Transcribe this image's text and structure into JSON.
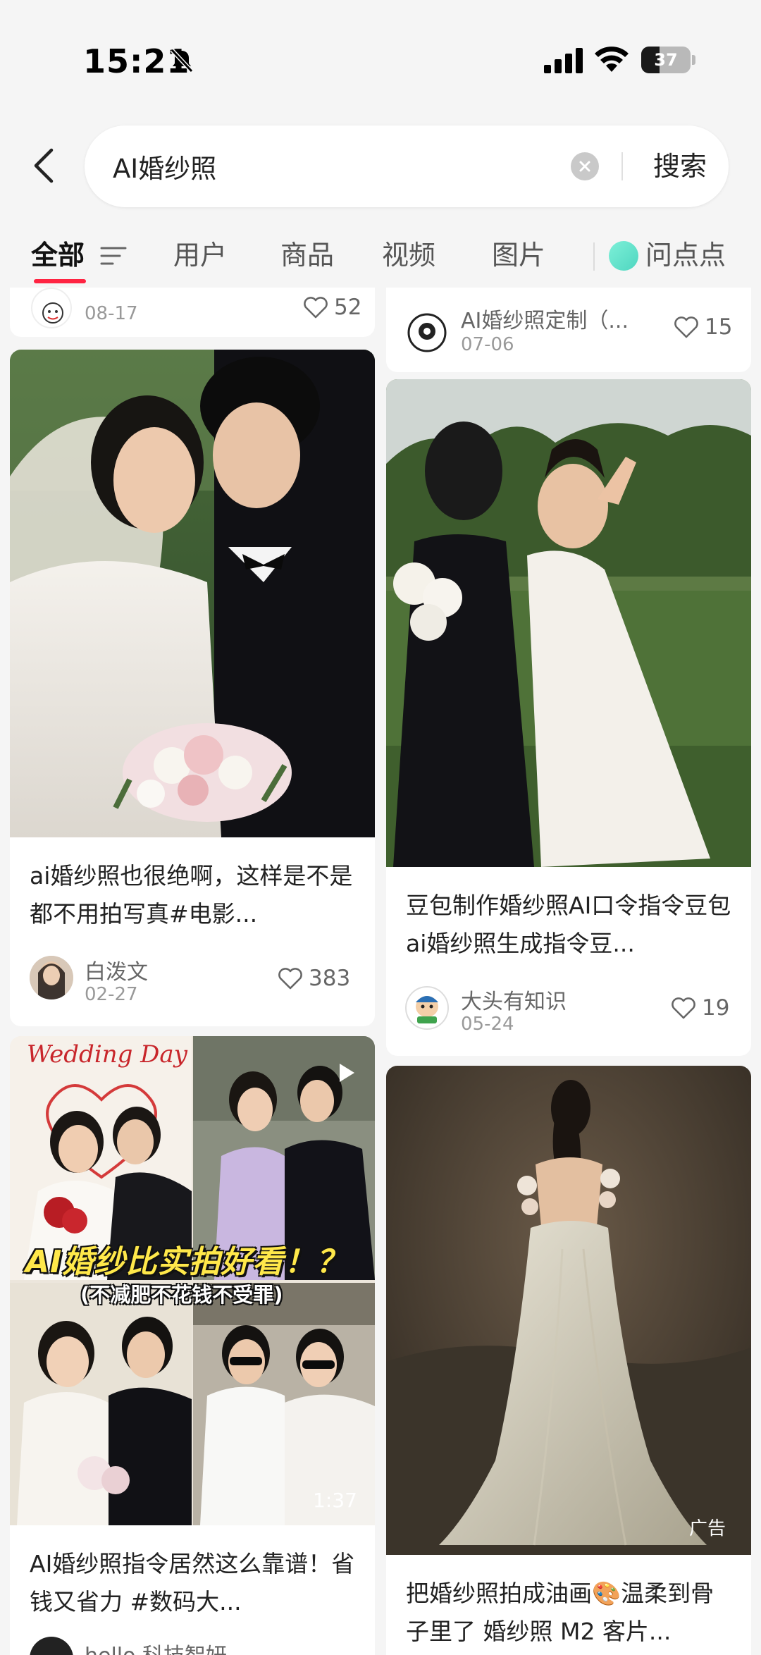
{
  "status_bar": {
    "time": "15:21",
    "battery": "37",
    "battery_level": 0.37
  },
  "search": {
    "query": "AI婚纱照",
    "button_label": "搜索"
  },
  "tabs": [
    {
      "label": "全部",
      "active": true
    },
    {
      "label": "用户"
    },
    {
      "label": "商品"
    },
    {
      "label": "视频"
    },
    {
      "label": "图片"
    },
    {
      "label": "问点点"
    }
  ],
  "feed": {
    "cards": [
      {
        "id": "top-left",
        "date": "08-17",
        "likes": "52"
      },
      {
        "id": "top-right",
        "author": "AI婚纱照定制（...",
        "date": "07-06",
        "likes": "15"
      },
      {
        "id": "card-1",
        "title": "ai婚纱照也很绝啊，这样是不是都不用拍写真#电影...",
        "author": "白泼文",
        "date": "02-27",
        "likes": "383"
      },
      {
        "id": "card-2",
        "title": "豆包制作婚纱照AI口令指令豆包ai婚纱照生成指令豆...",
        "author": "大头有知识",
        "date": "05-24",
        "likes": "19"
      },
      {
        "id": "card-3",
        "title": "AI婚纱照指令居然这么靠谱！省钱又省力 #数码大...",
        "author": "hello 科技智妍",
        "duration": "1:37",
        "overlay": {
          "headline": "Wedding Day",
          "banner": "AI婚纱比实拍好看！？",
          "subtitle": "(不减肥不花钱不受罪)"
        }
      },
      {
        "id": "card-4",
        "title": "把婚纱照拍成油画🎨温柔到骨子里了 婚纱照 M2 客片...",
        "ad_label": "广告"
      }
    ]
  },
  "colors": {
    "accent": "#ff2442",
    "background": "#f5f5f5",
    "ai_dot": "#5fe0c8"
  }
}
